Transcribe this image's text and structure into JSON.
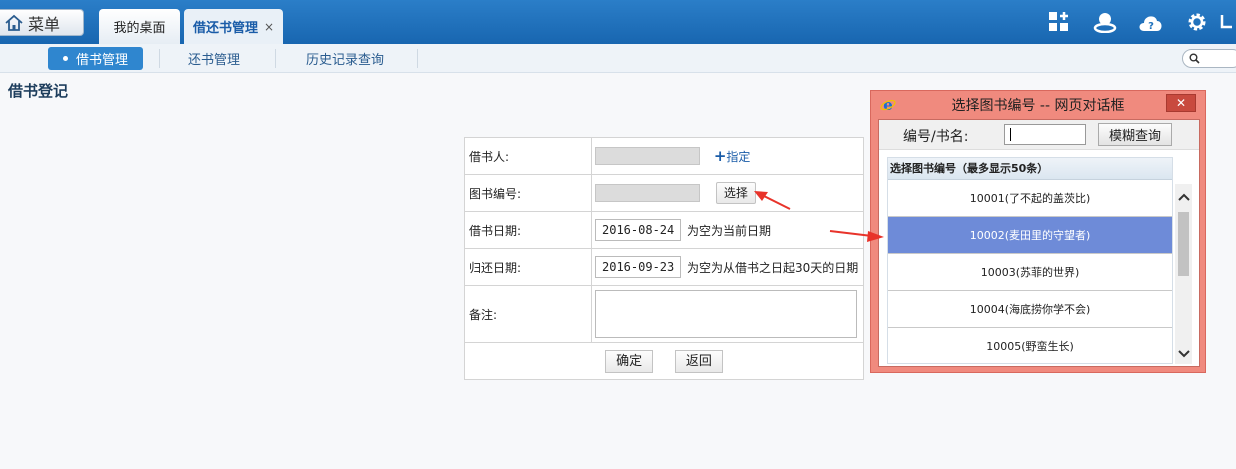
{
  "header": {
    "menu_label": "菜单",
    "tabs": [
      {
        "label": "我的桌面"
      },
      {
        "label": "借还书管理",
        "close": "×"
      }
    ],
    "icons": [
      "dashboard-add-icon",
      "user-icon",
      "help-cloud-icon",
      "gear-icon",
      "cup-icon"
    ]
  },
  "subnav": {
    "items": [
      {
        "label": "借书管理",
        "active": true
      },
      {
        "label": "还书管理"
      },
      {
        "label": "历史记录查询"
      }
    ]
  },
  "page": {
    "title": "借书登记"
  },
  "form": {
    "borrower_label": "借书人:",
    "borrower_value": "",
    "assign_label": "指定",
    "book_no_label": "图书编号:",
    "book_no_value": "",
    "select_label": "选择",
    "borrow_date_label": "借书日期:",
    "borrow_date_value": "2016-08-24",
    "borrow_date_hint": "为空为当前日期",
    "return_date_label": "归还日期:",
    "return_date_value": "2016-09-23",
    "return_date_hint": "为空为从借书之日起30天的日期",
    "remarks_label": "备注:",
    "remarks_value": "",
    "confirm_label": "确定",
    "back_label": "返回"
  },
  "dialog": {
    "title": "选择图书编号 -- 网页对话框",
    "close": "✕",
    "search_label": "编号/书名:",
    "search_value": "",
    "search_button": "模糊查询",
    "list_header": "选择图书编号（最多显示50条）",
    "items": [
      {
        "label": "10001(了不起的盖茨比)",
        "selected": false
      },
      {
        "label": "10002(麦田里的守望者)",
        "selected": true
      },
      {
        "label": "10003(苏菲的世界)",
        "selected": false
      },
      {
        "label": "10004(海底捞你学不会)",
        "selected": false
      },
      {
        "label": "10005(野蛮生长)",
        "selected": false
      }
    ]
  },
  "colors": {
    "topbar": "#1f72bd",
    "active_subtab": "#2f86cf",
    "dialog_frame": "#f08a7e",
    "selected_row": "#6e8bd8",
    "annotation_arrow": "#e8332a"
  }
}
